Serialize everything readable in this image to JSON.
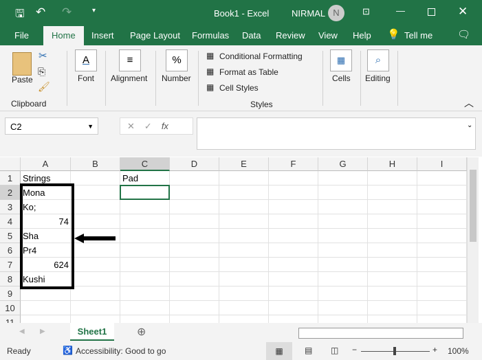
{
  "title_bar": {
    "doc_title": "Book1  -  Excel",
    "user": "NIRMAL",
    "avatar_initial": "N"
  },
  "tabs": [
    "File",
    "Home",
    "Insert",
    "Page Layout",
    "Formulas",
    "Data",
    "Review",
    "View",
    "Help",
    "Tell me"
  ],
  "ribbon": {
    "paste": "Paste",
    "clipboard": "Clipboard",
    "font": "Font",
    "alignment": "Alignment",
    "number": "Number",
    "conditional_formatting": "Conditional Formatting",
    "format_as_table": "Format as Table",
    "cell_styles": "Cell Styles",
    "styles": "Styles",
    "cells": "Cells",
    "editing": "Editing"
  },
  "formula_bar": {
    "name_box": "C2",
    "fx": "fx",
    "formula": ""
  },
  "columns": [
    "A",
    "B",
    "C",
    "D",
    "E",
    "F",
    "G",
    "H",
    "I"
  ],
  "rows": [
    "1",
    "2",
    "3",
    "4",
    "5",
    "6",
    "7",
    "8",
    "9",
    "10",
    "11"
  ],
  "cells": {
    "A1": "Strings",
    "C1": "Pad",
    "A2": "Mona",
    "A3": "Ko;",
    "A4": "74",
    "A5": "Sha",
    "A6": "Pr4",
    "A7": "624",
    "A8": "Kushi"
  },
  "sheet_tabs": [
    "Sheet1"
  ],
  "status": {
    "ready": "Ready",
    "accessibility": "Accessibility: Good to go",
    "zoom": "100%"
  },
  "colors": {
    "accent": "#217346",
    "annotation": "#000000"
  }
}
